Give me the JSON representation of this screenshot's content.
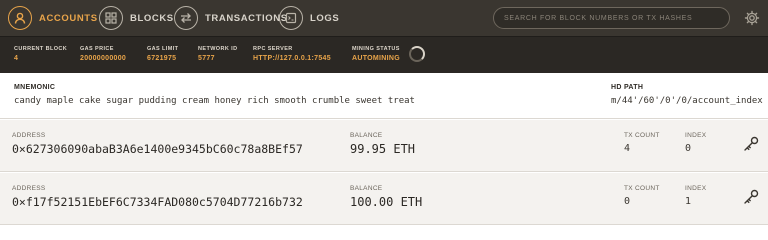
{
  "nav": {
    "items": [
      {
        "label": "ACCOUNTS",
        "icon": "user-icon",
        "active": true
      },
      {
        "label": "BLOCKS",
        "icon": "blocks-icon",
        "active": false
      },
      {
        "label": "TRANSACTIONS",
        "icon": "transactions-icon",
        "active": false
      },
      {
        "label": "LOGS",
        "icon": "logs-icon",
        "active": false
      }
    ],
    "search_placeholder": "SEARCH FOR BLOCK NUMBERS OR TX HASHES",
    "settings_icon": "gear-icon"
  },
  "status": {
    "current_block": {
      "label": "CURRENT BLOCK",
      "value": "4"
    },
    "gas_price": {
      "label": "GAS PRICE",
      "value": "20000000000"
    },
    "gas_limit": {
      "label": "GAS LIMIT",
      "value": "6721975"
    },
    "network_id": {
      "label": "NETWORK ID",
      "value": "5777"
    },
    "rpc_server": {
      "label": "RPC SERVER",
      "value": "HTTP://127.0.0.1:7545"
    },
    "mining_status": {
      "label": "MINING STATUS",
      "value": "AUTOMINING"
    }
  },
  "mnemonic": {
    "label": "MNEMONIC",
    "value": "candy maple cake sugar pudding cream honey rich smooth crumble sweet treat"
  },
  "hd_path": {
    "label": "HD PATH",
    "value": "m/44'/60'/0'/0/account_index"
  },
  "account_labels": {
    "address": "ADDRESS",
    "balance": "BALANCE",
    "tx_count": "TX COUNT",
    "index": "INDEX"
  },
  "accounts": [
    {
      "address": "0×627306090abaB3A6e1400e9345bC60c78a8BEf57",
      "balance": "99.95 ETH",
      "tx_count": "4",
      "index": "0"
    },
    {
      "address": "0×f17f52151EbEF6C7334FAD080c5704D77216b732",
      "balance": "100.00 ETH",
      "tx_count": "0",
      "index": "1"
    }
  ],
  "colors": {
    "accent": "#e8a44a",
    "nav_bg": "#3a3630",
    "status_bg": "#2b2824"
  }
}
